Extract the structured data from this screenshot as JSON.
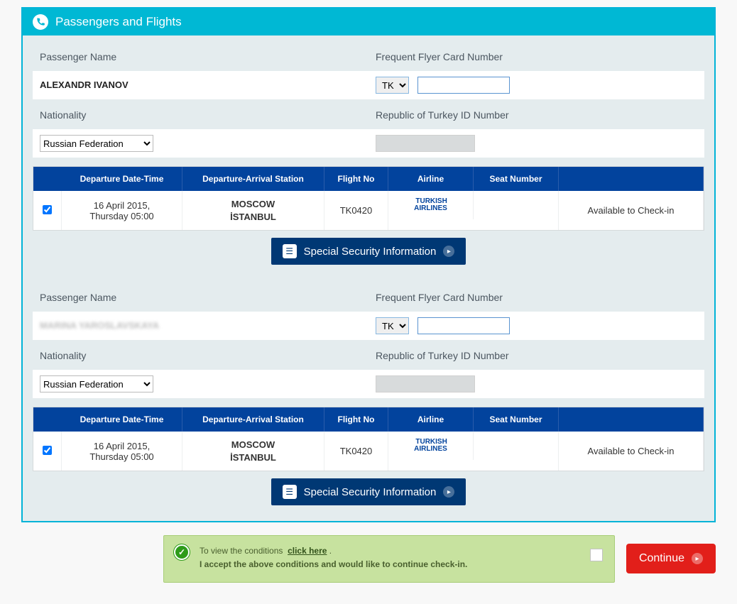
{
  "panel": {
    "title": "Passengers and Flights"
  },
  "labels": {
    "passengerName": "Passenger Name",
    "frequentFlyer": "Frequent Flyer Card Number",
    "nationality": "Nationality",
    "turkeyId": "Republic of Turkey ID Number"
  },
  "tableHeaders": {
    "dateTime": "Departure Date-Time",
    "route": "Departure-Arrival Station",
    "flightNo": "Flight No",
    "airline": "Airline",
    "seat": "Seat Number"
  },
  "passengers": [
    {
      "name": "ALEXANDR IVANOV",
      "blurred": false,
      "ffPrefix": "TK",
      "ffNumber": "",
      "nationality": "Russian Federation",
      "turkeyId": "",
      "flight": {
        "date": "16 April 2015,",
        "dayTime": "Thursday 05:00",
        "from": "MOSCOW",
        "to": "İSTANBUL",
        "no": "TK0420",
        "airlineTop": "TURKISH",
        "airlineBottom": "AIRLINES",
        "seat": "",
        "status": "Available to Check-in"
      }
    },
    {
      "name": "MARINA YAROSLAVSKAYA",
      "blurred": true,
      "ffPrefix": "TK",
      "ffNumber": "",
      "nationality": "Russian Federation",
      "turkeyId": "",
      "flight": {
        "date": "16 April 2015,",
        "dayTime": "Thursday 05:00",
        "from": "MOSCOW",
        "to": "İSTANBUL",
        "no": "TK0420",
        "airlineTop": "TURKISH",
        "airlineBottom": "AIRLINES",
        "seat": "",
        "status": "Available to Check-in"
      }
    }
  ],
  "specialBtn": "Special Security Information",
  "conditions": {
    "line1a": "To view the conditions",
    "link": "click here",
    "period": ".",
    "line2": "I accept the above conditions and would like to continue check-in."
  },
  "continueLabel": "Continue",
  "colors": {
    "primary": "#00b8d4",
    "navy": "#02439d",
    "darkNavy": "#003874",
    "green": "#c7e29f",
    "red": "#e21f1a"
  }
}
